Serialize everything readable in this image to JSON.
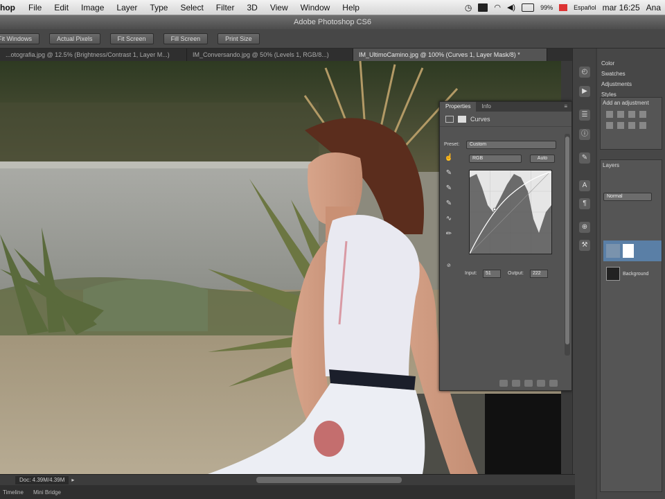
{
  "menubar": {
    "app": "hop",
    "items": [
      "File",
      "Edit",
      "Image",
      "Layer",
      "Type",
      "Select",
      "Filter",
      "3D",
      "View",
      "Window",
      "Help"
    ],
    "language": "Español",
    "clock": "mar 16:25",
    "user": "Ana",
    "battery": "99%"
  },
  "titlebar": {
    "title": "Adobe Photoshop CS6"
  },
  "options": {
    "buttons": [
      "Fit Windows",
      "Actual Pixels",
      "Fit Screen",
      "Fill Screen",
      "Print Size"
    ]
  },
  "tabs": [
    {
      "label": "...otografia.jpg @ 12.5% (Brightness/Contrast 1, Layer M...)",
      "active": false
    },
    {
      "label": "IM_Conversando.jpg @ 50% (Levels 1, RGB/8...)",
      "active": false
    },
    {
      "label": "IM_UltimoCamino.jpg @ 100% (Curves 1, Layer Mask/8) *",
      "active": true
    }
  ],
  "curves": {
    "panel_tabs": [
      "Properties",
      "Info"
    ],
    "title": "Curves",
    "preset_label": "Preset:",
    "preset_value": "Custom",
    "channel_value": "RGB",
    "auto_label": "Auto",
    "input_label": "Input:",
    "input_value": "51",
    "output_label": "Output:",
    "output_value": "222"
  },
  "right": {
    "panel_tabs": [
      "Color",
      "Swatches",
      "Adjustments",
      "Styles"
    ],
    "add_adjustment": "Add an adjustment",
    "layers_tab": "Layers",
    "blend_mode": "Normal",
    "layer_name": "Background"
  },
  "status": {
    "doc": "Doc: 4.39M/4.39M"
  },
  "bottom_tabs": [
    "Timeline",
    "Mini Bridge"
  ],
  "colors": {
    "panel": "#535353",
    "dock": "#424242",
    "accent_curve": "#ffffff"
  }
}
